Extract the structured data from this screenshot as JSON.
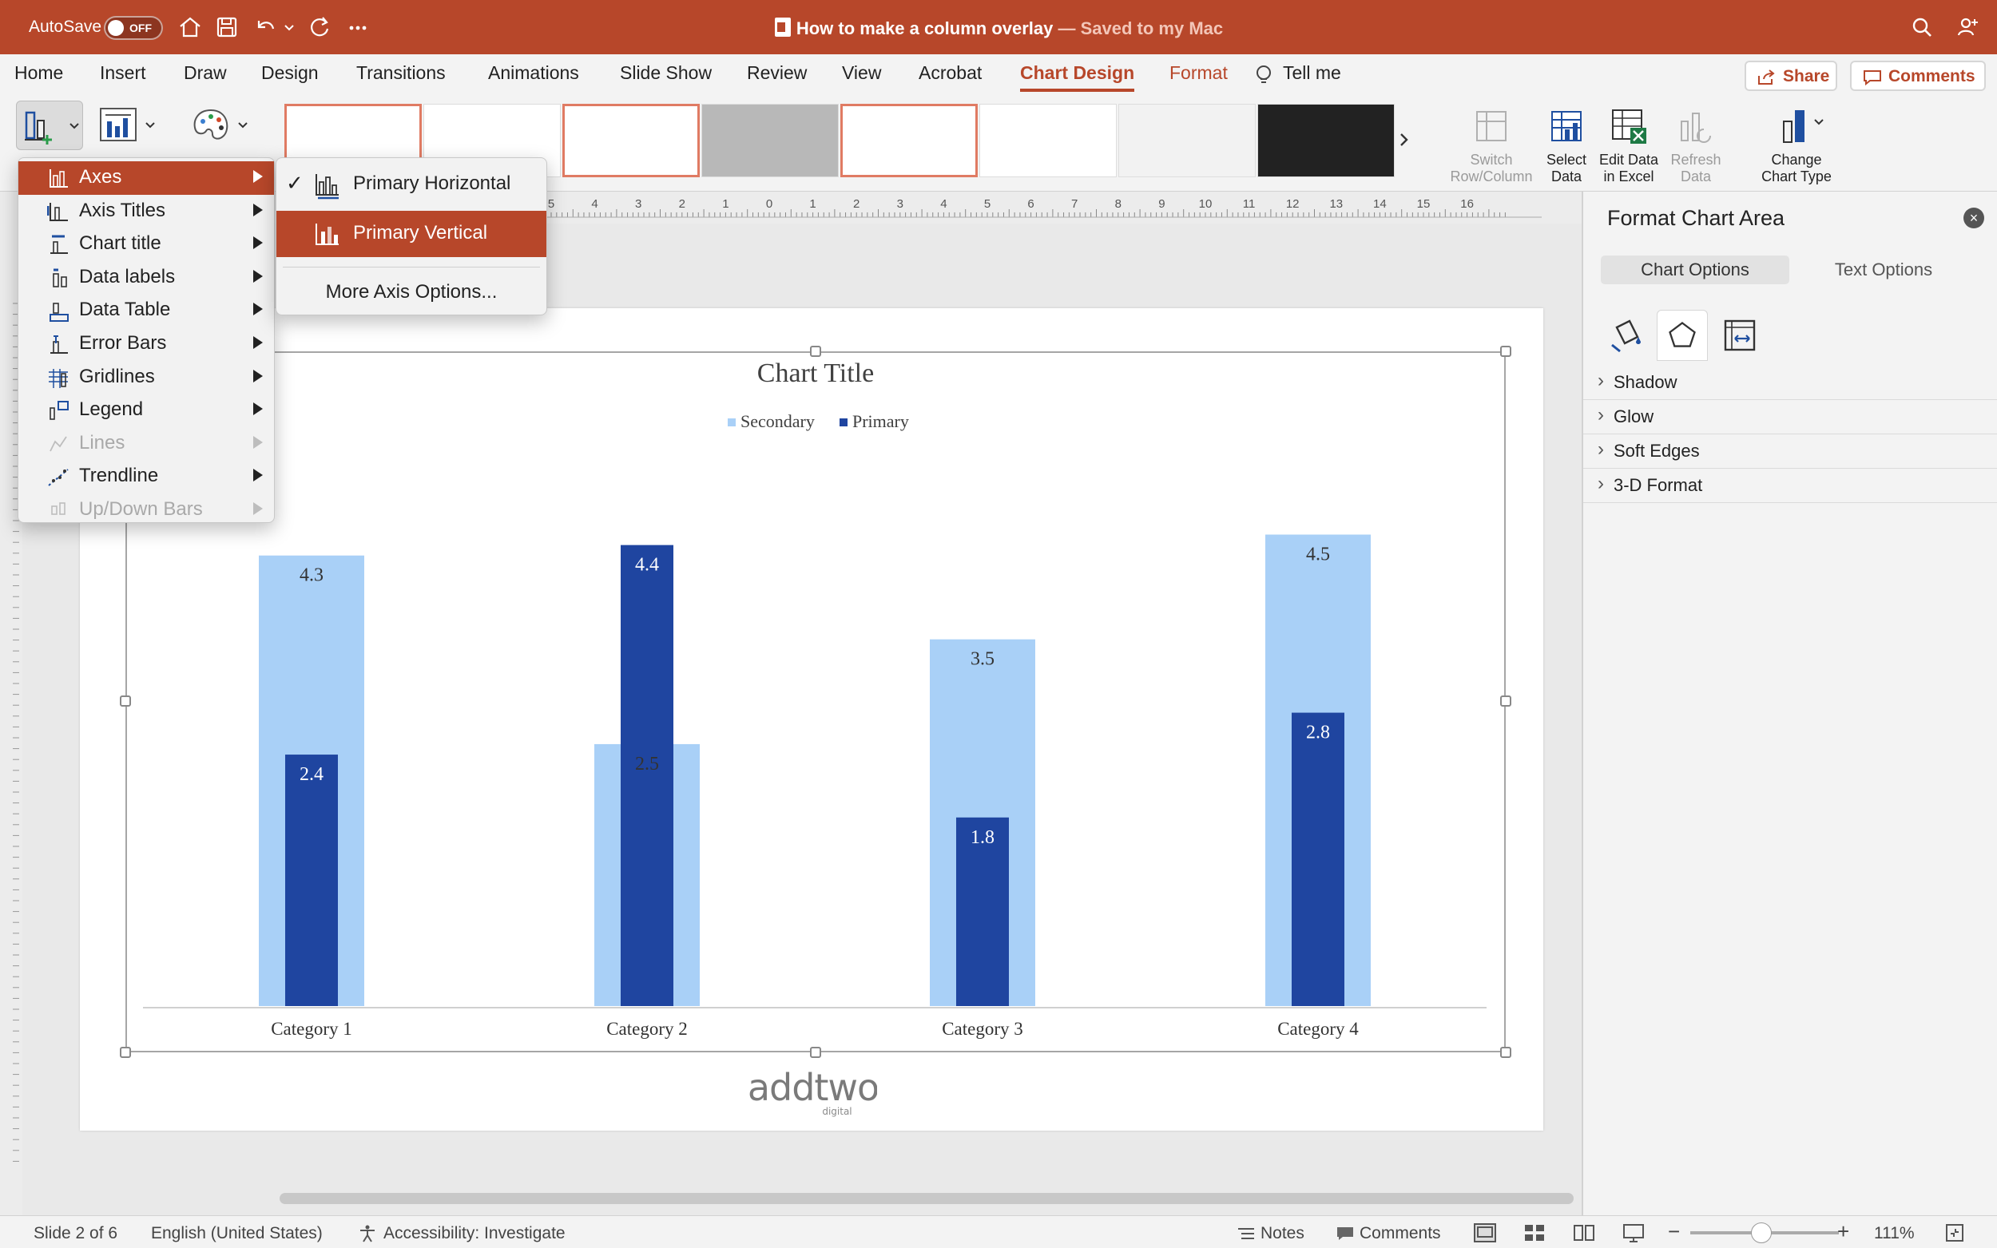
{
  "titlebar": {
    "autosave_label": "AutoSave",
    "autosave_state": "OFF",
    "doc_title": "How to make a column overlay",
    "saved_status": "— Saved to my Mac"
  },
  "tabs": [
    "Home",
    "Insert",
    "Draw",
    "Design",
    "Transitions",
    "Animations",
    "Slide Show",
    "Review",
    "View",
    "Acrobat",
    "Chart Design",
    "Format",
    "Tell me"
  ],
  "active_tab": "Chart Design",
  "share_label": "Share",
  "comments_label": "Comments",
  "ribbon": {
    "switch_row_col": [
      "Switch",
      "Row/Column"
    ],
    "select_data": [
      "Select",
      "Data"
    ],
    "edit_data": [
      "Edit Data",
      "in Excel"
    ],
    "refresh_data": [
      "Refresh",
      "Data"
    ],
    "change_chart_type": [
      "Change",
      "Chart Type"
    ]
  },
  "ruler_labels": [
    "5",
    "4",
    "3",
    "2",
    "1",
    "0",
    "1",
    "2",
    "3",
    "4",
    "5",
    "6",
    "7",
    "8",
    "9",
    "10",
    "11",
    "12",
    "13",
    "14",
    "15",
    "16"
  ],
  "add_chart_element_menu": [
    {
      "label": "Axes",
      "icon": "axes-icon",
      "state": "highlighted"
    },
    {
      "label": "Axis Titles",
      "icon": "axis-titles-icon",
      "state": "normal"
    },
    {
      "label": "Chart title",
      "icon": "chart-title-icon",
      "state": "normal"
    },
    {
      "label": "Data labels",
      "icon": "data-labels-icon",
      "state": "normal"
    },
    {
      "label": "Data Table",
      "icon": "data-table-icon",
      "state": "normal"
    },
    {
      "label": "Error Bars",
      "icon": "error-bars-icon",
      "state": "normal"
    },
    {
      "label": "Gridlines",
      "icon": "gridlines-icon",
      "state": "normal"
    },
    {
      "label": "Legend",
      "icon": "legend-icon",
      "state": "normal"
    },
    {
      "label": "Lines",
      "icon": "lines-icon",
      "state": "disabled"
    },
    {
      "label": "Trendline",
      "icon": "trendline-icon",
      "state": "normal"
    },
    {
      "label": "Up/Down Bars",
      "icon": "up-down-bars-icon",
      "state": "disabled"
    }
  ],
  "axes_submenu": {
    "primary_horizontal": "Primary Horizontal",
    "primary_horizontal_checked": true,
    "primary_vertical": "Primary Vertical",
    "more_options": "More Axis Options..."
  },
  "chart_data": {
    "type": "bar",
    "title": "Chart Title",
    "categories": [
      "Category 1",
      "Category 2",
      "Category 3",
      "Category 4"
    ],
    "series": [
      {
        "name": "Secondary",
        "values": [
          4.3,
          2.5,
          3.5,
          4.5
        ],
        "color": "#a9d0f7",
        "axis": "secondary"
      },
      {
        "name": "Primary",
        "values": [
          2.4,
          4.4,
          1.8,
          2.8
        ],
        "color": "#1f45a0",
        "axis": "primary"
      }
    ],
    "secondary_ylim": [
      0,
      5
    ],
    "primary_ylim": [
      0,
      5
    ],
    "legend_position": "top",
    "xlabel": "",
    "ylabel": "",
    "grid": false
  },
  "logo_text": "addtwo",
  "logo_sub": "digital",
  "format_pane": {
    "title": "Format Chart Area",
    "tab_chart_options": "Chart Options",
    "tab_text_options": "Text Options",
    "sections": [
      "Shadow",
      "Glow",
      "Soft Edges",
      "3-D Format"
    ]
  },
  "status": {
    "slide": "Slide 2 of 6",
    "language": "English (United States)",
    "accessibility": "Accessibility: Investigate",
    "notes": "Notes",
    "comments": "Comments",
    "zoom": "111%"
  },
  "colors": {
    "brand": "#b7472a",
    "secondary_series": "#a9d0f7",
    "primary_series": "#1f45a0"
  }
}
